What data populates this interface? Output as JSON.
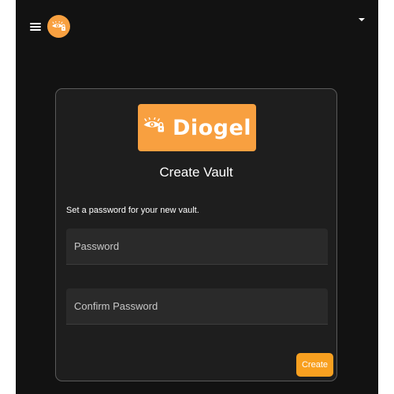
{
  "header": {
    "menu_icon": "hamburger-menu-icon",
    "logo_icon": "diogel-logo-icon",
    "dropdown_icon": "caret-down-icon"
  },
  "brand": {
    "name": "Diogel",
    "color": "#f8a040"
  },
  "card": {
    "title": "Create Vault",
    "subtitle": "Set a password for your new vault."
  },
  "form": {
    "password_placeholder": "Password",
    "confirm_placeholder": "Confirm Password",
    "password_value": "",
    "confirm_value": "",
    "create_label": "Create"
  },
  "colors": {
    "accent": "#f8a020",
    "background": "#121212",
    "card": "#1e1e1e",
    "field": "#2a2a2a"
  }
}
